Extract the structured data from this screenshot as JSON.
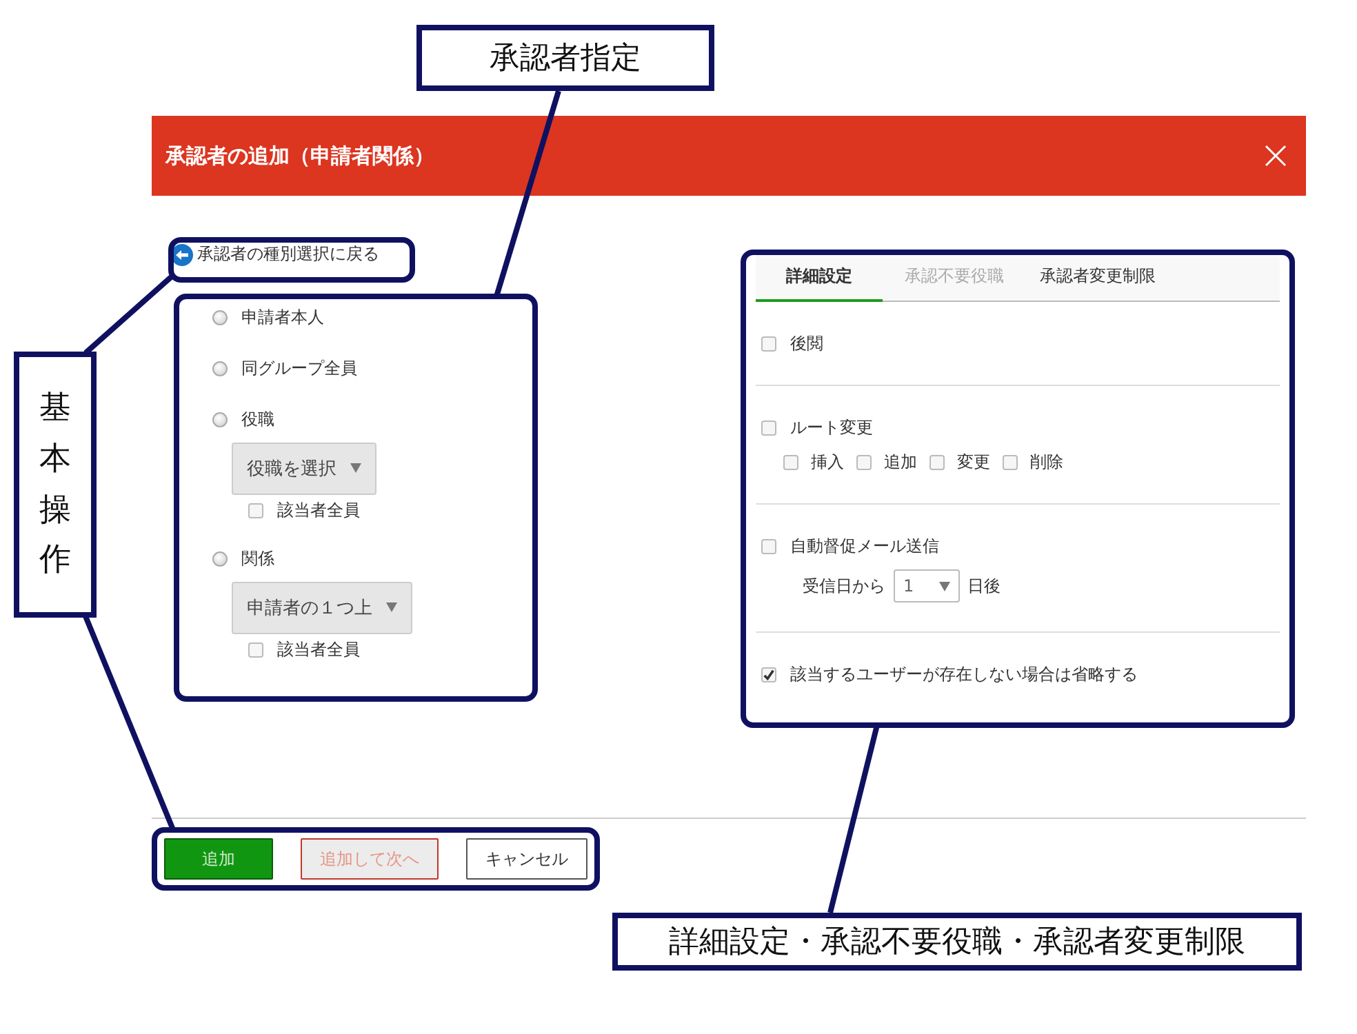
{
  "dialog": {
    "title": "承認者の追加（申請者関係）"
  },
  "back_link": "承認者の種別選択に戻る",
  "approver_options": [
    {
      "label": "申請者本人",
      "selected": false
    },
    {
      "label": "同グループ全員",
      "selected": false
    },
    {
      "label": "役職",
      "selected": false,
      "dropdown": "役職を選択",
      "all_members": {
        "label": "該当者全員",
        "checked": false
      }
    },
    {
      "label": "関係",
      "selected": false,
      "dropdown": "申請者の１つ上",
      "all_members": {
        "label": "該当者全員",
        "checked": false
      }
    }
  ],
  "tabs": [
    {
      "label": "詳細設定",
      "selected": true,
      "disabled": false
    },
    {
      "label": "承認不要役職",
      "selected": false,
      "disabled": true
    },
    {
      "label": "承認者変更制限",
      "selected": false,
      "disabled": false
    }
  ],
  "settings": [
    {
      "label": "後閲",
      "checked": false
    },
    {
      "label": "ルート変更",
      "checked": false,
      "options": [
        {
          "label": "挿入",
          "checked": false
        },
        {
          "label": "追加",
          "checked": false
        },
        {
          "label": "変更",
          "checked": false
        },
        {
          "label": "削除",
          "checked": false
        }
      ]
    },
    {
      "label": "自動督促メール送信",
      "checked": false,
      "reminder": {
        "before": "受信日から",
        "value": "1",
        "after": "日後"
      }
    },
    {
      "label": "該当するユーザーが存在しない場合は省略する",
      "checked": true
    }
  ],
  "buttons": [
    {
      "label": "追加",
      "kind": "primary"
    },
    {
      "label": "追加して次へ",
      "kind": "disabled"
    },
    {
      "label": "キャンセル",
      "kind": "default"
    }
  ],
  "annotations": [
    {
      "text": "承認者指定"
    },
    {
      "text": "基本操作"
    },
    {
      "text": "詳細設定・承認不要役職・承認者変更制限"
    }
  ]
}
